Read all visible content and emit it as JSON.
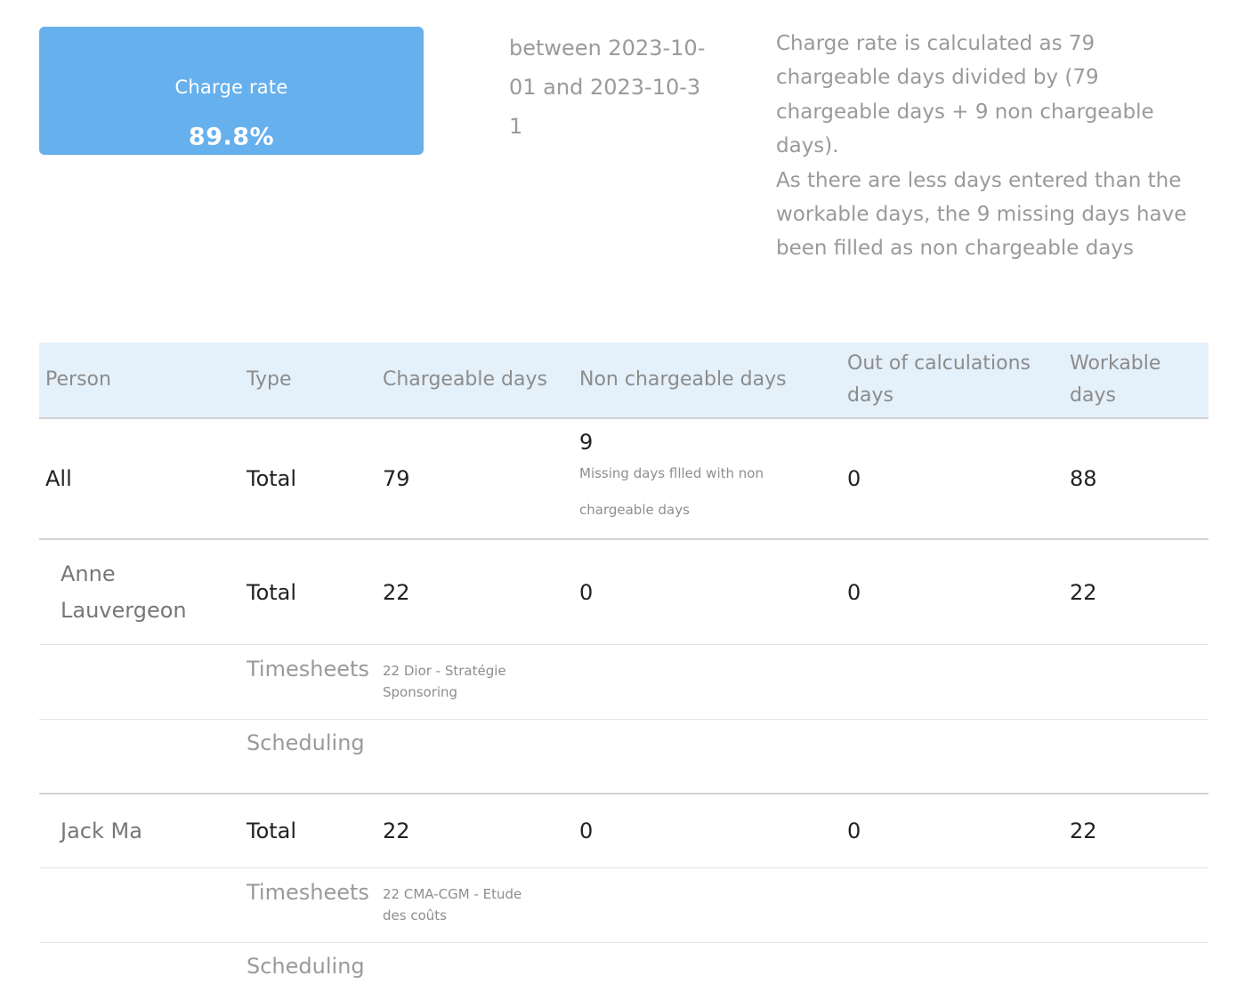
{
  "summary": {
    "rate_label": "Charge rate",
    "rate_value": "89.8%",
    "period": "between 2023-10-01 and 2023-10-31",
    "explanation": "Charge rate is calculated as 79 chargeable days divided by (79 chargeable days + 9 non chargeable days).",
    "explanation_note": "As there are less days entered than the workable days, the 9 missing days have been filled as non chargeable days",
    "card_color": "#66b0ed"
  },
  "table": {
    "headers": {
      "person": "Person",
      "type": "Type",
      "chargeable": "Chargeable days",
      "non_chargeable": "Non chargeable days",
      "out_of_calc": "Out of calculations days",
      "workable": "Workable days"
    },
    "all": {
      "person": "All",
      "type": "Total",
      "chargeable": "79",
      "non_chargeable": "9",
      "non_chargeable_note": "Missing days fllled with non chargeable days",
      "out_of_calc": "0",
      "workable": "88"
    },
    "people": [
      {
        "person": "Anne Lauvergeon",
        "type": "Total",
        "chargeable": "22",
        "non_chargeable": "0",
        "out_of_calc": "0",
        "workable": "22",
        "timesheets_label": "Timesheets",
        "timesheets_detail": "22 Dior - Stratégie Sponsoring",
        "scheduling_label": "Scheduling"
      },
      {
        "person": "Jack Ma",
        "type": "Total",
        "chargeable": "22",
        "non_chargeable": "0",
        "out_of_calc": "0",
        "workable": "22",
        "timesheets_label": "Timesheets",
        "timesheets_detail": "22 CMA-CGM - Etude des coûts",
        "scheduling_label": "Scheduling"
      }
    ]
  }
}
